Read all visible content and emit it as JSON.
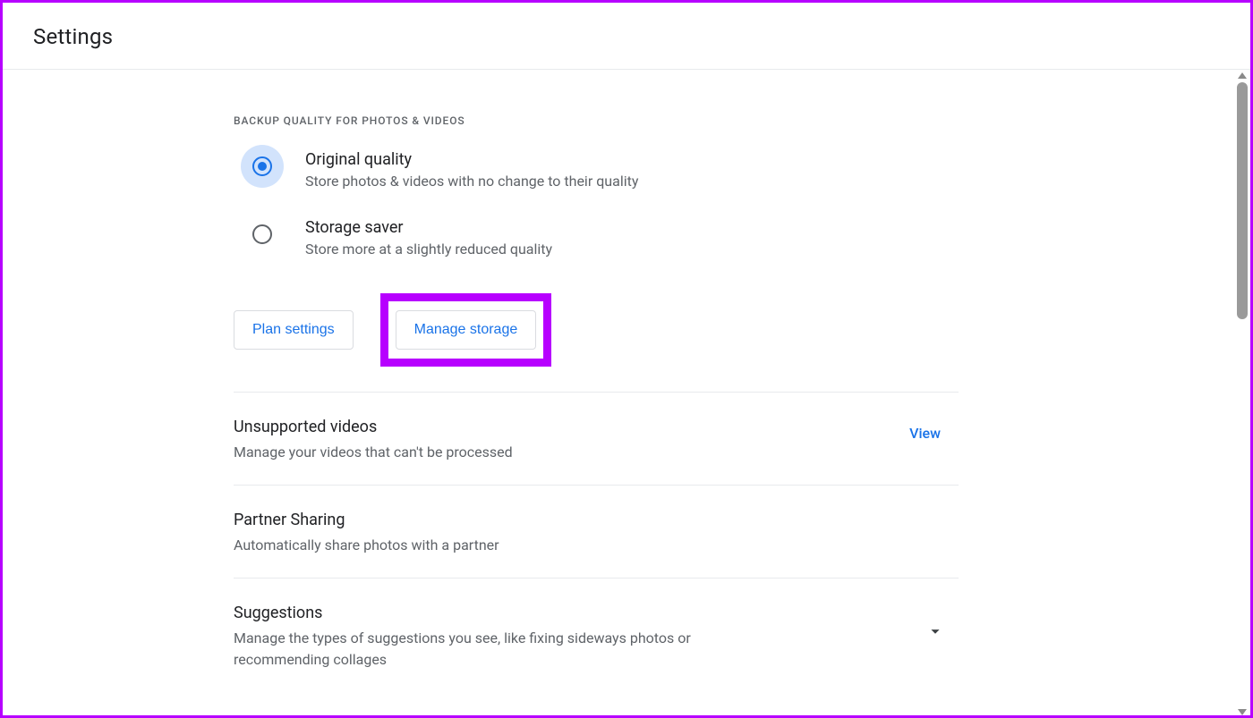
{
  "header": {
    "title": "Settings"
  },
  "backup": {
    "section_label": "BACKUP QUALITY FOR PHOTOS & VIDEOS",
    "option_original": {
      "title": "Original quality",
      "sub": "Store photos & videos with no change to their quality"
    },
    "option_saver": {
      "title": "Storage saver",
      "sub": "Store more at a slightly reduced quality"
    },
    "plan_settings_label": "Plan settings",
    "manage_storage_label": "Manage storage"
  },
  "rows": {
    "unsupported": {
      "title": "Unsupported videos",
      "sub": "Manage your videos that can't be processed",
      "action": "View"
    },
    "partner": {
      "title": "Partner Sharing",
      "sub": "Automatically share photos with a partner"
    },
    "suggestions": {
      "title": "Suggestions",
      "sub": "Manage the types of suggestions you see, like fixing sideways photos or recommending collages"
    }
  }
}
